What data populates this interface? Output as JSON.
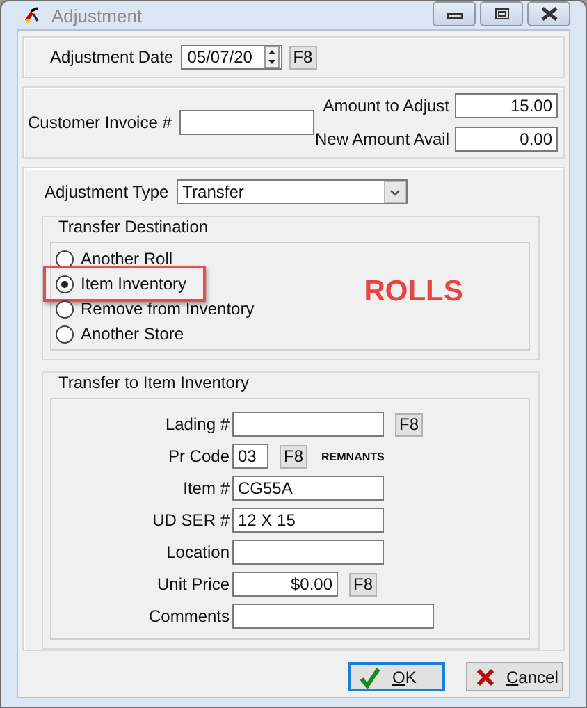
{
  "window": {
    "title": "Adjustment"
  },
  "date": {
    "label": "Adjustment Date",
    "value": "05/07/20",
    "lookup": "F8"
  },
  "invoice": {
    "label": "Customer Invoice #"
  },
  "amounts": [
    {
      "label": "Amount to Adjust",
      "value": "15.00"
    },
    {
      "label": "New Amount Avail",
      "value": "0.00"
    }
  ],
  "adjustment_type": {
    "label": "Adjustment Type",
    "value": "Transfer"
  },
  "transfer_destination": {
    "title": "Transfer Destination",
    "annotation": "ROLLS",
    "options": [
      {
        "label": "Another Roll",
        "selected": false,
        "highlighted": false
      },
      {
        "label": "Item Inventory",
        "selected": true,
        "highlighted": true
      },
      {
        "label": "Remove from Inventory",
        "selected": false,
        "highlighted": false
      },
      {
        "label": "Another Store",
        "selected": false,
        "highlighted": false
      }
    ]
  },
  "item_inventory": {
    "title": "Transfer to Item Inventory",
    "fields": [
      {
        "label": "Lading #",
        "kind": "text",
        "lookup": "F8"
      },
      {
        "label": "Pr Code",
        "kind": "code",
        "value": "03",
        "lookup": "F8",
        "note": "REMNANTS"
      },
      {
        "label": "Item #",
        "kind": "text",
        "value": "CG55A"
      },
      {
        "label": "UD SER #",
        "kind": "text",
        "value": "12 X 15"
      },
      {
        "label": "Location",
        "kind": "text"
      },
      {
        "label": "Unit Price",
        "kind": "price",
        "value": "$0.00",
        "lookup": "F8"
      },
      {
        "label": "Comments",
        "kind": "note"
      }
    ]
  },
  "buttons": [
    {
      "label": "OK",
      "kind": "ok",
      "focused": true
    },
    {
      "label": "Cancel",
      "kind": "cancel",
      "focused": false
    }
  ]
}
